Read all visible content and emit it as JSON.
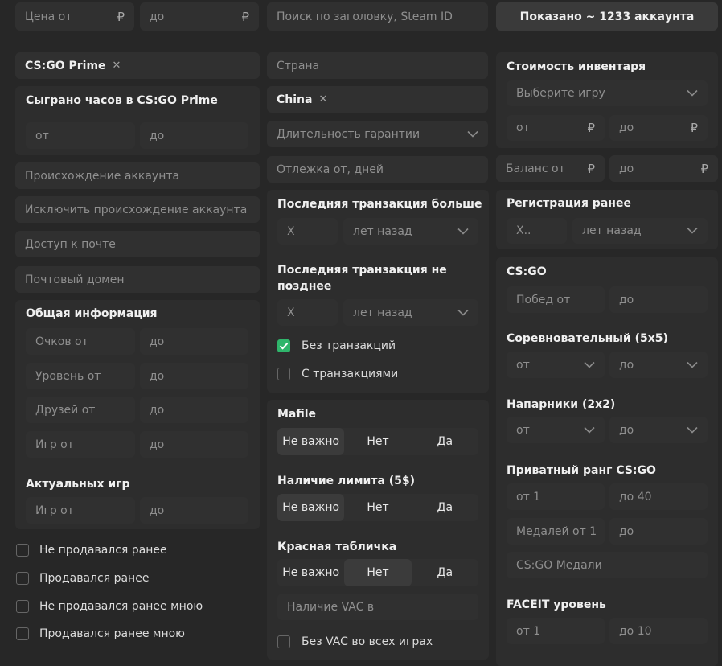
{
  "top": {
    "price_from": "Цена от",
    "price_to": "до",
    "currency": "₽",
    "search_placeholder": "Поиск по заголовку, Steam ID",
    "shown_button": "Показано ~ 1233 аккаунта"
  },
  "col1": {
    "game_tag": "CS:GO Prime",
    "remove": "✕",
    "hours_title": "Сыграно часов в CS:GO Prime",
    "hours_from": "от",
    "hours_to": "до",
    "origin": "Происхождение аккаунта",
    "exclude_origin": "Исключить происхождение аккаунта",
    "mail_access": "Доступ к почте",
    "mail_domain": "Почтовый домен",
    "general_title": "Общая информация",
    "points_from": "Очков от",
    "level_from": "Уровень от",
    "friends_from": "Друзей от",
    "games_from": "Игр от",
    "to": "до",
    "actual_games_title": "Актуальных игр",
    "actual_games_from": "Игр от",
    "checks": [
      "Не продавался ранее",
      "Продавался ранее",
      "Не продавался ранее мною",
      "Продавался ранее мною"
    ]
  },
  "col2": {
    "country": "Страна",
    "country_tag": "China",
    "guarantee": "Длительность гарантии",
    "rest_days": "Отлежка от, дней",
    "last_tx_more_title": "Последняя транзакция больше",
    "last_tx_not_later_title": "Последняя транзакция не позднее",
    "x_value": "X",
    "years_ago": "лет назад",
    "no_tx": "Без транзакций",
    "with_tx": "С транзакциями",
    "mafile_title": "Мafile",
    "limit_title": "Наличие лимита (5$)",
    "red_plate_title": "Красная табличка",
    "opt_any": "Не важно",
    "opt_no": "Нет",
    "opt_yes": "Да",
    "vac_placeholder": "Наличие VAC в",
    "no_vac_all": "Без VAC во всех играх"
  },
  "col3": {
    "inventory_title": "Стоимость инвентаря",
    "select_game": "Выберите игру",
    "from": "от",
    "to": "до",
    "balance_from": "Баланс от",
    "reg_title": "Регистрация ранее",
    "reg_x": "X..",
    "years_ago": "лет назад",
    "csgo_title": "CS:GO",
    "wins_from": "Побед от",
    "competitive_title": "Соревновательный (5x5)",
    "wingman_title": "Напарники (2x2)",
    "private_rank_title": "Приватный ранг CS:GO",
    "rank_from": "от 1",
    "rank_to": "до 40",
    "medals_from": "Медалей от 1",
    "medals": "CS:GO Медали",
    "faceit_title": "FACEIT уровень",
    "faceit_from": "от 1",
    "faceit_to": "до 10"
  },
  "colors": {
    "background": "#272727",
    "field": "#303030",
    "panel": "#2d2d2d",
    "check_active": "#2fb56b"
  }
}
